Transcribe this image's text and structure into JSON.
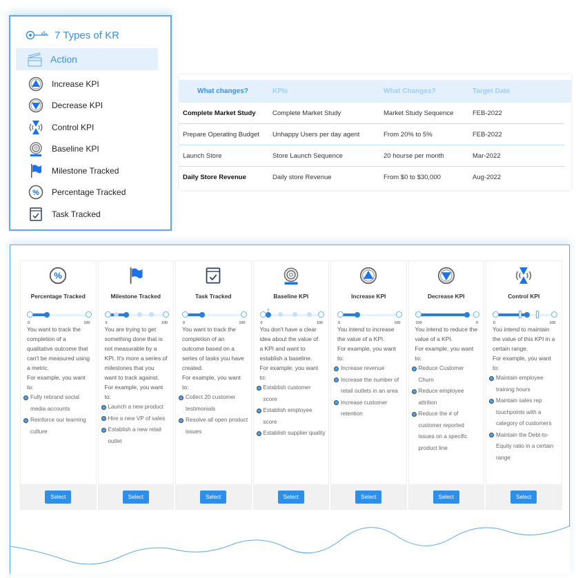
{
  "menu": {
    "title": "7 Types of KR",
    "items": [
      {
        "label": "Action",
        "icon": "clapperboard-icon"
      },
      {
        "label": "Increase KPI",
        "icon": "increase-kpi-icon"
      },
      {
        "label": "Decrease KPI",
        "icon": "decrease-kpi-icon"
      },
      {
        "label": "Control KPI",
        "icon": "control-kpi-icon"
      },
      {
        "label": "Baseline KPI",
        "icon": "baseline-kpi-icon"
      },
      {
        "label": "Milestone Tracked",
        "icon": "flag-icon"
      },
      {
        "label": "Percentage Tracked",
        "icon": "percent-icon"
      },
      {
        "label": "Task Tracked",
        "icon": "task-icon"
      }
    ]
  },
  "table": {
    "headers": [
      "What changes?",
      "KPIs",
      "What Changes?",
      "Target Date"
    ],
    "rows": [
      [
        "Complete Market Study",
        "Complete Market Study",
        "Market Study Sequence",
        "FEB-2022"
      ],
      [
        "Prepare Operating Budget",
        "Unhappy Users per day agent",
        "From 20% to 5%",
        "FEB-2022"
      ],
      [
        "Launch Store",
        "Store Launch Sequence",
        "20 hourse per month",
        "Mar-2022"
      ],
      [
        "Daily Store Revenue",
        "Daily store Revenue",
        "From $0 to $30,000",
        "Aug-2022"
      ]
    ]
  },
  "colors": {
    "accent": "#2d8fe8",
    "border": "#5aa9f0",
    "header_bg": "#e4f1fd"
  },
  "cards": [
    {
      "name": "Percentage Tracked",
      "icon": "percent-icon",
      "slider": {
        "min": "0",
        "max": "100",
        "value": 0.3
      },
      "desc": [
        "You want to track the completion of a qualitative outcome that can't be measured using a metric.",
        "For example, you want to:"
      ],
      "bullets": [
        "Fully rebrand social media accounts",
        "Reinforce our learning culture"
      ],
      "button": "Select"
    },
    {
      "name": "Milestone Tracked",
      "icon": "flag-icon",
      "slider": {
        "min": "0",
        "max": "100",
        "value": 0.33,
        "milestones": [
          0.15,
          0.33,
          0.55,
          0.75
        ]
      },
      "desc": [
        "You are trying to get something done that is not measurable by a KPI. It's more a series of milestones that you want to track against.",
        "For example, you want to:"
      ],
      "bullets": [
        "Launch a new product",
        "Hire a new VP of sales",
        "Establish a new retail outlet"
      ],
      "button": "Select"
    },
    {
      "name": "Task Tracked",
      "icon": "task-icon",
      "slider": {
        "min": "0",
        "max": "100",
        "value": 0.3
      },
      "desc": [
        "You want to track the completion of an outcome based on a series of tasks you have created.",
        "For example, you want to:"
      ],
      "bullets": [
        "Collect 20 customer testimonials",
        "Resolve all open product issues"
      ],
      "button": "Select"
    },
    {
      "name": "Baseline KPI",
      "icon": "baseline-kpi-icon",
      "slider": {
        "min": "0",
        "max": "100",
        "value": 0.1,
        "marker": "?",
        "milestones": [
          0.3,
          0.55,
          0.8
        ]
      },
      "desc": [
        "You don't have a clear idea about the value of a KPI and want to establish a baseline.",
        "For example, you want to:"
      ],
      "bullets": [
        "Establish customer score",
        "Establish employee score",
        "Establish supplier quality"
      ],
      "button": "Select"
    },
    {
      "name": "Increase KPI",
      "icon": "increase-kpi-icon",
      "slider": {
        "min": "0",
        "max": "100",
        "value": 0.3
      },
      "desc": [
        "You intend to increase the value of a KPI.",
        "For example, you want to:"
      ],
      "bullets": [
        "Increase revenue",
        "Increase the number of retail outlets in an area",
        "Increase customer retention"
      ],
      "button": "Select"
    },
    {
      "name": "Decrease KPI",
      "icon": "decrease-kpi-icon",
      "slider": {
        "min": "100",
        "max": "0",
        "value": 0.85
      },
      "desc": [
        "You intend to reduce the value of a KPI.",
        "For example, you want to:"
      ],
      "bullets": [
        "Reduce Customer Churn",
        "Reduce employee attrition",
        "Reduce the # of customer reported issues on a specific product line"
      ],
      "button": "Select"
    },
    {
      "name": "Control KPI",
      "icon": "control-kpi-icon",
      "slider": {
        "min": "0",
        "max": "100",
        "value": 0.55,
        "range": [
          0.4,
          0.7
        ]
      },
      "desc": [
        "You intend to maintain the value of this KPI in a certain range.",
        "For example, you want to:"
      ],
      "bullets": [
        "Maintain employee training hours",
        "Maintain sales rep touchpoints with a category of customers",
        "Maintain the Debt-to-Equity ratio in a certain range"
      ],
      "button": "Select"
    }
  ]
}
